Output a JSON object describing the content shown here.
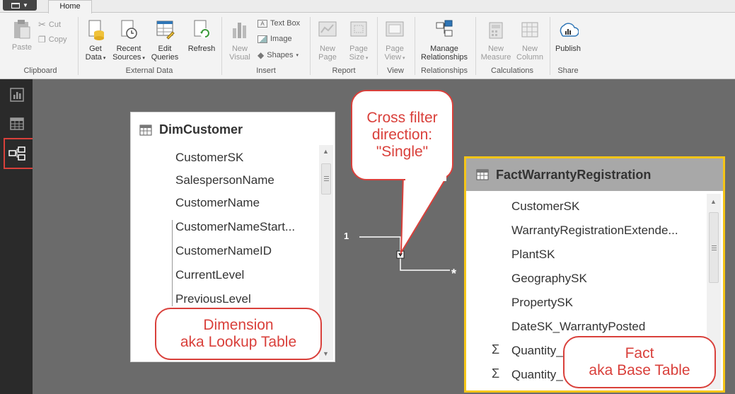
{
  "ribbon": {
    "file_menu_label": "",
    "tabs": [
      {
        "label": "Home",
        "active": true
      }
    ],
    "groups": {
      "clipboard": {
        "label": "Clipboard",
        "paste": "Paste",
        "cut": "Cut",
        "copy": "Copy"
      },
      "external_data": {
        "label": "External Data",
        "get_data_1": "Get",
        "get_data_2": "Data",
        "recent_sources_1": "Recent",
        "recent_sources_2": "Sources",
        "edit_queries_1": "Edit",
        "edit_queries_2": "Queries",
        "refresh": "Refresh"
      },
      "insert": {
        "label": "Insert",
        "new_visual_1": "New",
        "new_visual_2": "Visual",
        "text_box": "Text Box",
        "image": "Image",
        "shapes": "Shapes"
      },
      "report": {
        "label": "Report",
        "new_page_1": "New",
        "new_page_2": "Page",
        "page_size_1": "Page",
        "page_size_2": "Size"
      },
      "view": {
        "label": "View",
        "page_view_1": "Page",
        "page_view_2": "View"
      },
      "relationships": {
        "label": "Relationships",
        "manage_1": "Manage",
        "manage_2": "Relationships"
      },
      "calculations": {
        "label": "Calculations",
        "new_measure_1": "New",
        "new_measure_2": "Measure",
        "new_column_1": "New",
        "new_column_2": "Column"
      },
      "share": {
        "label": "Share",
        "publish": "Publish"
      }
    }
  },
  "rail": {
    "items": [
      {
        "icon": "report-view-icon"
      },
      {
        "icon": "data-view-icon"
      },
      {
        "icon": "relationships-view-icon",
        "active": true
      }
    ]
  },
  "diagram": {
    "dim_table": {
      "name": "DimCustomer",
      "fields": [
        "CustomerSK",
        "SalespersonName",
        "CustomerName",
        "CustomerNameStart...",
        "CustomerNameID",
        "CurrentLevel",
        "PreviousLevel"
      ]
    },
    "fact_table": {
      "name": "FactWarrantyRegistration",
      "fields": [
        "CustomerSK",
        "WarrantyRegistrationExtende...",
        "PlantSK",
        "GeographySK",
        "PropertySK",
        "DateSK_WarrantyPosted",
        "Quantity_",
        "Quantity_"
      ],
      "measure_icon": "Σ"
    },
    "relationship": {
      "one_side": "1",
      "many_side": "*"
    }
  },
  "callouts": {
    "cross_filter": [
      "Cross filter",
      "direction:",
      "\"Single\""
    ],
    "dimension": [
      "Dimension",
      "aka Lookup Table"
    ],
    "fact": [
      "Fact",
      "aka Base Table"
    ]
  },
  "colors": {
    "accent_red": "#d9403b",
    "selected_border": "#f5c518",
    "canvas": "#6b6b6b",
    "rail": "#2a2a2a"
  }
}
